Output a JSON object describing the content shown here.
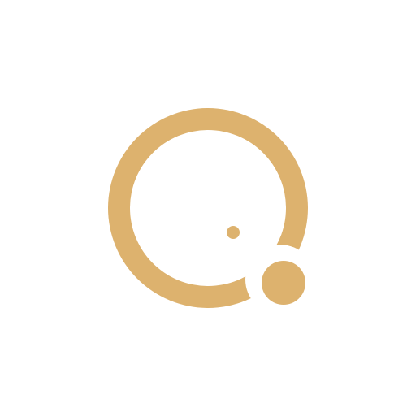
{
  "logo": {
    "icon": "ring-with-dots-logo",
    "color": "#DDB26E",
    "background": "#FFFFFF"
  }
}
